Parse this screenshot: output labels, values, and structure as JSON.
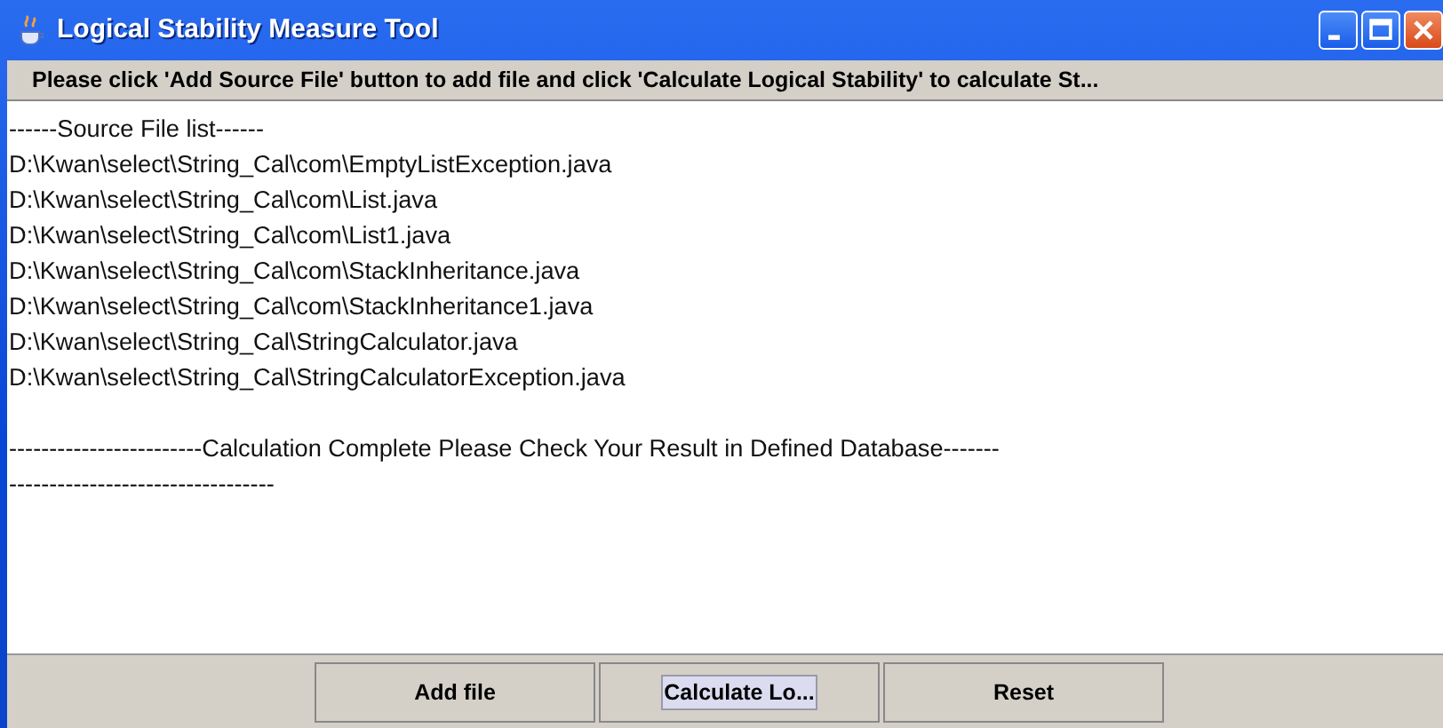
{
  "window": {
    "title": "Logical Stability Measure Tool"
  },
  "instruction": "Please click 'Add Source File' button to add file and click  'Calculate Logical Stability' to calculate St...",
  "log": {
    "header": "------Source File list------",
    "files": [
      "D:\\Kwan\\select\\String_Cal\\com\\EmptyListException.java",
      "D:\\Kwan\\select\\String_Cal\\com\\List.java",
      "D:\\Kwan\\select\\String_Cal\\com\\List1.java",
      "D:\\Kwan\\select\\String_Cal\\com\\StackInheritance.java",
      "D:\\Kwan\\select\\String_Cal\\com\\StackInheritance1.java",
      "D:\\Kwan\\select\\String_Cal\\StringCalculator.java",
      "D:\\Kwan\\select\\String_Cal\\StringCalculatorException.java"
    ],
    "message": " ------------------------Calculation Complete Please Check Your Result in Defined Database----------------------------------------"
  },
  "buttons": [
    {
      "label": "Add file",
      "focused": false
    },
    {
      "label": "Calculate Lo...",
      "focused": true
    },
    {
      "label": "Reset",
      "focused": false
    }
  ]
}
